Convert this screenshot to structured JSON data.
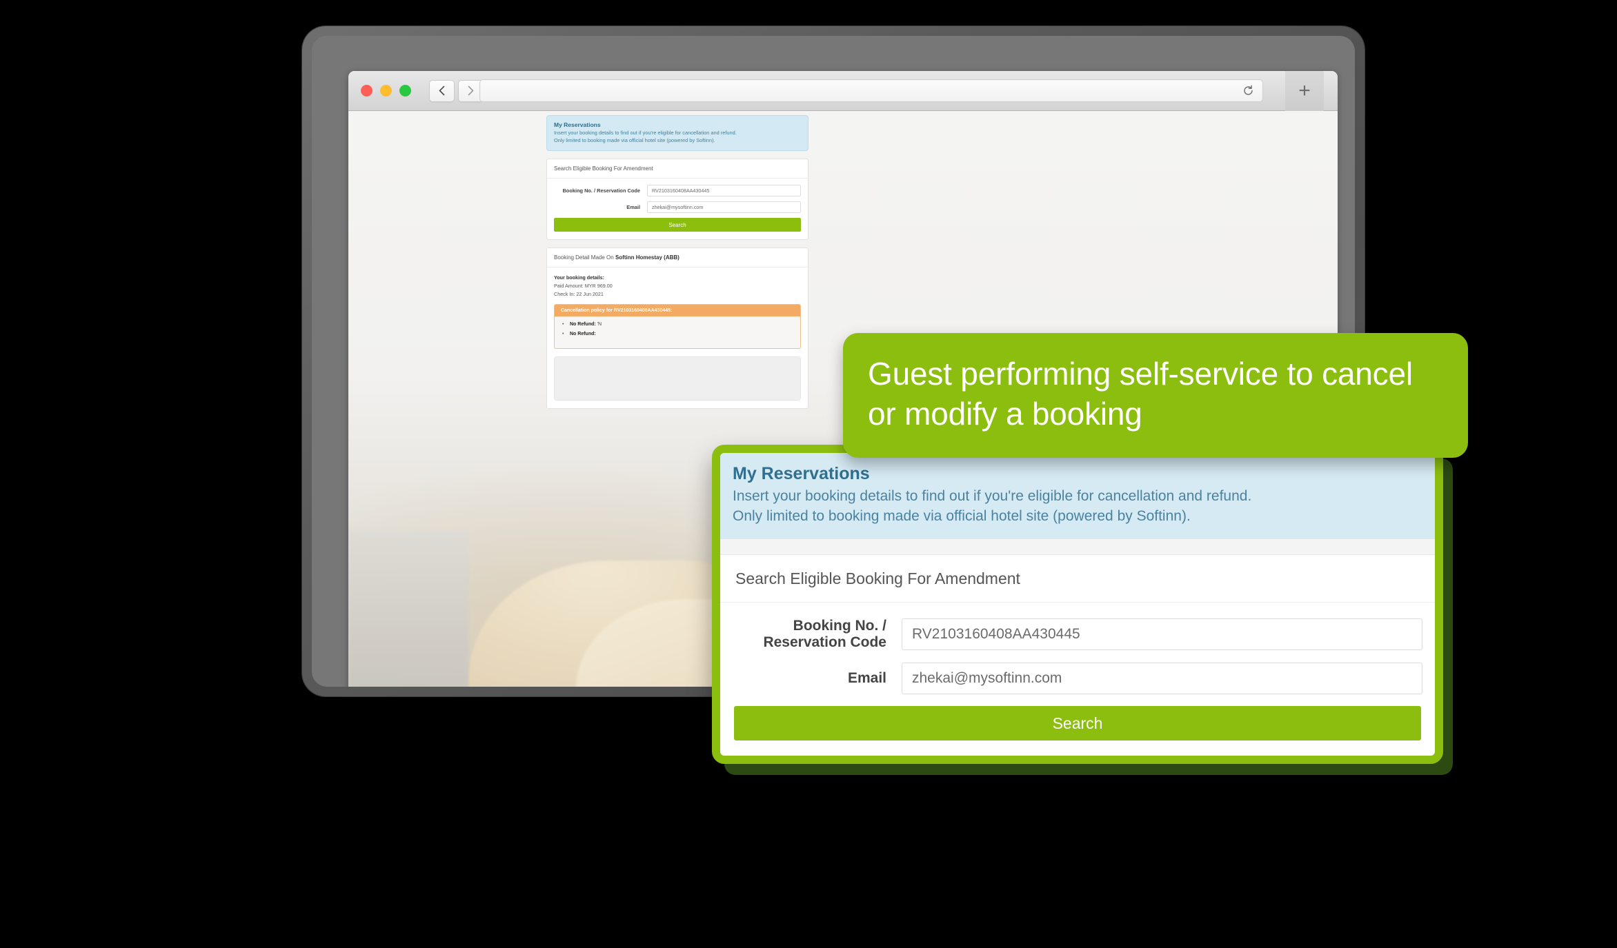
{
  "browser": {
    "traffic_lights": [
      "close-red",
      "minimize-yellow",
      "maximize-green"
    ],
    "back_glyph": "‹",
    "forward_glyph": "›",
    "reload_glyph": "↻",
    "newtab_glyph": "+",
    "url_value": "",
    "url_placeholder": ""
  },
  "callout": {
    "text": "Guest performing self-service to cancel or modify a booking",
    "color": "#8cbe10"
  },
  "reservations": {
    "title": "My Reservations",
    "line1": "Insert your booking details to find out if you're eligible for cancellation and refund.",
    "line2": "Only limited to booking made via official hotel site (powered by Softinn)."
  },
  "search_form": {
    "heading": "Search Eligible Booking For Amendment",
    "booking_label": "Booking No. / Reservation Code",
    "booking_value": "RV2103160408AA430445",
    "email_label": "Email",
    "email_value": "zhekai@mysoftinn.com",
    "submit_label": "Search"
  },
  "booking_detail": {
    "heading_prefix": "Booking Detail Made On ",
    "heading_property": "Softinn Homestay (ABB)",
    "details_title": "Your booking details:",
    "paid_amount": "Paid Amount: MYR 969.00",
    "check_in": "Check In: 22 Jun 2021",
    "policy_header": "Cancellation policy for RV2103160408AA430445:",
    "policy_items": [
      {
        "label": "No Refund:",
        "text": " 'N"
      },
      {
        "label": "No Refund:",
        "text": ""
      }
    ]
  },
  "colors": {
    "green": "#8cbe10",
    "green_shadow": "#2c4a12",
    "info_blue_bg": "#d6eaf4",
    "info_blue_text": "#4a82a0",
    "orange": "#f3aa62"
  }
}
